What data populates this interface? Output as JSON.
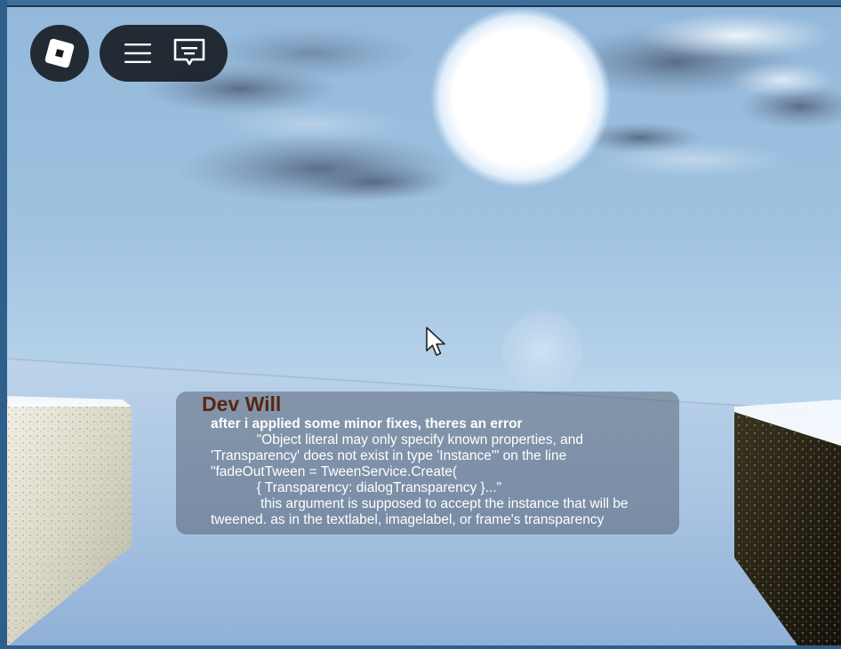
{
  "topbar": {
    "roblox_button": {
      "icon": "roblox-logo-icon"
    },
    "menu_button": {
      "icon": "hamburger-menu-icon"
    },
    "chat_button": {
      "icon": "chat-bubble-icon"
    }
  },
  "dialog": {
    "speaker": "Dev Will",
    "lines": [
      "after i applied some minor fixes, theres an error",
      "            \"Object literal may only specify known properties, and",
      "'Transparency' does not exist in type 'Instance'\" on the line",
      "\"fadeOutTween = TweenService.Create(",
      "            { Transparency: dialogTransparency }...\"",
      "             this argument is supposed to accept the instance that will be",
      "tweened. as in the textlabel, imagelabel, or frame's transparency"
    ]
  },
  "colors": {
    "speaker": "#5b2410",
    "dialog_text": "#ffffff",
    "sky_top": "#8fb4d6",
    "snow": "#c9dcee"
  },
  "cursor": {
    "icon": "mouse-pointer-icon"
  }
}
